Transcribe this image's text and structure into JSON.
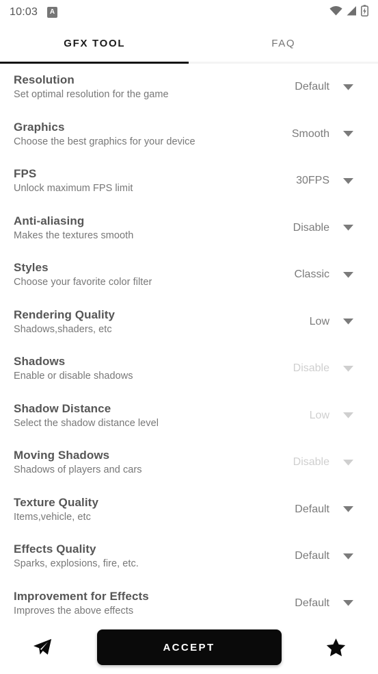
{
  "status_bar": {
    "clock": "10:03",
    "notification_badge": "A",
    "icons": [
      "wifi-icon",
      "cellular-signal-icon",
      "battery-charging-icon"
    ]
  },
  "tabs": [
    {
      "label": "GFX TOOL",
      "active": true
    },
    {
      "label": "FAQ",
      "active": false
    }
  ],
  "settings": [
    {
      "title": "Resolution",
      "subtitle": "Set optimal resolution for the game",
      "value": "Default",
      "enabled": true
    },
    {
      "title": "Graphics",
      "subtitle": "Choose the best graphics for your device",
      "value": "Smooth",
      "enabled": true
    },
    {
      "title": "FPS",
      "subtitle": "Unlock maximum FPS limit",
      "value": "30FPS",
      "enabled": true
    },
    {
      "title": "Anti-aliasing",
      "subtitle": "Makes the textures smooth",
      "value": "Disable",
      "enabled": true
    },
    {
      "title": "Styles",
      "subtitle": "Choose your favorite color filter",
      "value": "Classic",
      "enabled": true
    },
    {
      "title": "Rendering Quality",
      "subtitle": "Shadows,shaders, etc",
      "value": "Low",
      "enabled": true
    },
    {
      "title": "Shadows",
      "subtitle": "Enable or disable shadows",
      "value": "Disable",
      "enabled": false
    },
    {
      "title": "Shadow Distance",
      "subtitle": "Select the shadow distance level",
      "value": "Low",
      "enabled": false
    },
    {
      "title": "Moving Shadows",
      "subtitle": "Shadows of players and cars",
      "value": "Disable",
      "enabled": false
    },
    {
      "title": "Texture Quality",
      "subtitle": "Items,vehicle, etc",
      "value": "Default",
      "enabled": true
    },
    {
      "title": "Effects Quality",
      "subtitle": "Sparks, explosions, fire, etc.",
      "value": "Default",
      "enabled": true
    },
    {
      "title": "Improvement for Effects",
      "subtitle": "Improves the above effects",
      "value": "Default",
      "enabled": true
    }
  ],
  "bottom_bar": {
    "share_icon": "send-icon",
    "accept_label": "ACCEPT",
    "favorite_icon": "star-icon"
  },
  "colors": {
    "accent": "#0a0a0a",
    "title": "#565656",
    "subtitle": "#777777",
    "value": "#7b7b7b",
    "value_disabled": "#cfcfcf",
    "background": "#ffffff"
  }
}
